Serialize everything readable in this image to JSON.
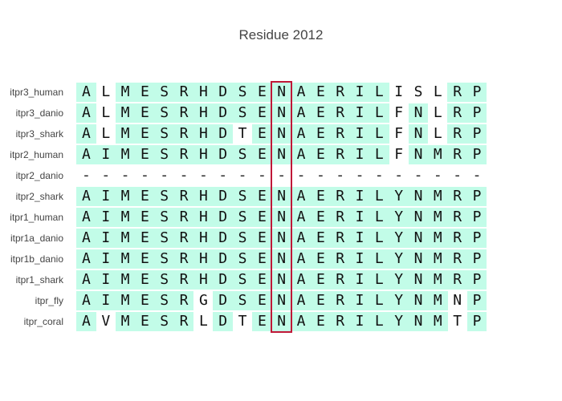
{
  "title": "Residue 2012",
  "colors": {
    "match": "#c2fce8",
    "highlight": "#c01838"
  },
  "highlight_column": 10,
  "sequences": [
    {
      "label": "itpr3_human",
      "residues": "ALMESRHDSENAERILISLRP",
      "match": [
        1,
        0,
        1,
        1,
        1,
        1,
        1,
        1,
        1,
        1,
        1,
        1,
        1,
        1,
        1,
        1,
        0,
        0,
        0,
        1,
        1
      ]
    },
    {
      "label": "itpr3_danio",
      "residues": "ALMESRHDSENAERILFNLRP",
      "match": [
        1,
        0,
        1,
        1,
        1,
        1,
        1,
        1,
        1,
        1,
        1,
        1,
        1,
        1,
        1,
        1,
        0,
        1,
        0,
        1,
        1
      ]
    },
    {
      "label": "itpr3_shark",
      "residues": "ALMESRHDTENAERILFNLRP",
      "match": [
        1,
        0,
        1,
        1,
        1,
        1,
        1,
        1,
        0,
        1,
        1,
        1,
        1,
        1,
        1,
        1,
        0,
        1,
        0,
        1,
        1
      ]
    },
    {
      "label": "itpr2_human",
      "residues": "AIMESRHDSENAERILFNMRP",
      "match": [
        1,
        1,
        1,
        1,
        1,
        1,
        1,
        1,
        1,
        1,
        1,
        1,
        1,
        1,
        1,
        1,
        0,
        1,
        1,
        1,
        1
      ]
    },
    {
      "label": "itpr2_danio",
      "residues": "---------------------",
      "match": [
        0,
        0,
        0,
        0,
        0,
        0,
        0,
        0,
        0,
        0,
        0,
        0,
        0,
        0,
        0,
        0,
        0,
        0,
        0,
        0,
        0
      ]
    },
    {
      "label": "itpr2_shark",
      "residues": "AIMESRHDSENAERILYNMRP",
      "match": [
        1,
        1,
        1,
        1,
        1,
        1,
        1,
        1,
        1,
        1,
        1,
        1,
        1,
        1,
        1,
        1,
        1,
        1,
        1,
        1,
        1
      ]
    },
    {
      "label": "itpr1_human",
      "residues": "AIMESRHDSENAERILYNMRP",
      "match": [
        1,
        1,
        1,
        1,
        1,
        1,
        1,
        1,
        1,
        1,
        1,
        1,
        1,
        1,
        1,
        1,
        1,
        1,
        1,
        1,
        1
      ]
    },
    {
      "label": "itpr1a_danio",
      "residues": "AIMESRHDSENAERILYNMRP",
      "match": [
        1,
        1,
        1,
        1,
        1,
        1,
        1,
        1,
        1,
        1,
        1,
        1,
        1,
        1,
        1,
        1,
        1,
        1,
        1,
        1,
        1
      ]
    },
    {
      "label": "itpr1b_danio",
      "residues": "AIMESRHDSENAERILYNMRP",
      "match": [
        1,
        1,
        1,
        1,
        1,
        1,
        1,
        1,
        1,
        1,
        1,
        1,
        1,
        1,
        1,
        1,
        1,
        1,
        1,
        1,
        1
      ]
    },
    {
      "label": "itpr1_shark",
      "residues": "AIMESRHDSENAERILYNMRP",
      "match": [
        1,
        1,
        1,
        1,
        1,
        1,
        1,
        1,
        1,
        1,
        1,
        1,
        1,
        1,
        1,
        1,
        1,
        1,
        1,
        1,
        1
      ]
    },
    {
      "label": "itpr_fly",
      "residues": "AIMESRGDSENAERILYNMNP",
      "match": [
        1,
        1,
        1,
        1,
        1,
        1,
        0,
        1,
        1,
        1,
        1,
        1,
        1,
        1,
        1,
        1,
        1,
        1,
        1,
        0,
        1
      ]
    },
    {
      "label": "itpr_coral",
      "residues": "AVMESRLDTENAERILYNMTP",
      "match": [
        1,
        0,
        1,
        1,
        1,
        1,
        0,
        1,
        0,
        1,
        1,
        1,
        1,
        1,
        1,
        1,
        1,
        1,
        1,
        0,
        1
      ]
    }
  ]
}
